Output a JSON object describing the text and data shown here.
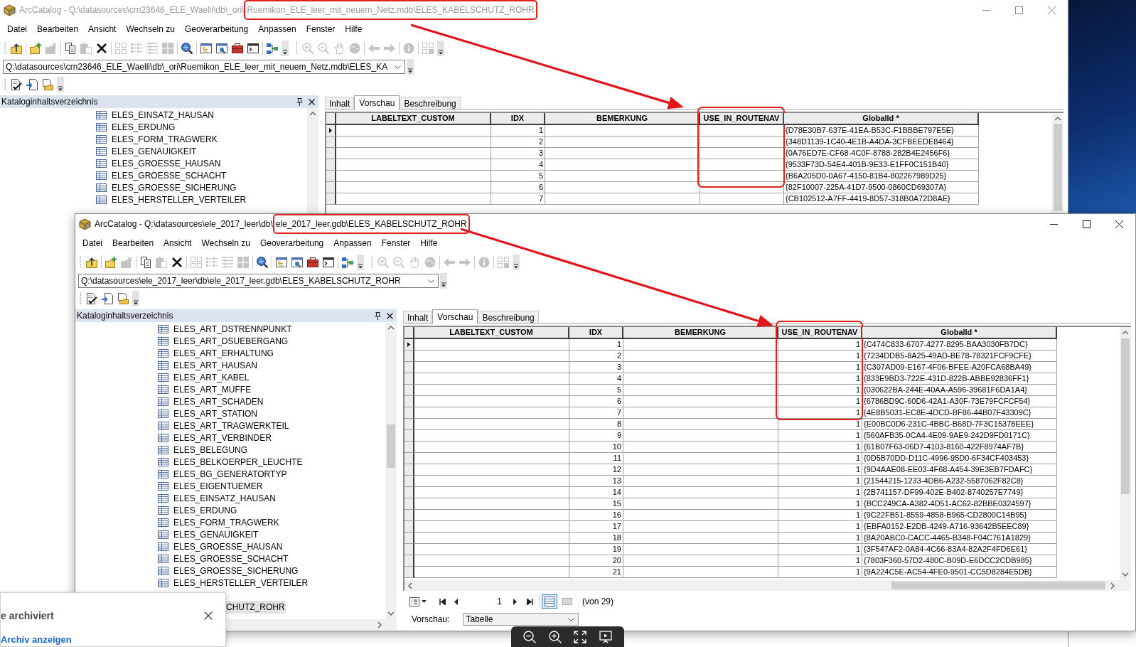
{
  "back_window": {
    "active": false,
    "title": "ArcCatalog - Q:\\datasources\\crn23646_ELE_Waelli\\db\\_ori\\",
    "title_marked": "Ruemikon_ELE_leer_mit_neuem_Netz.mdb\\ELES_KABELSCHUTZ_ROHR",
    "annotation_arrow": true,
    "menu": [
      "Datei",
      "Bearbeiten",
      "Ansicht",
      "Wechseln zu",
      "Geoverarbeitung",
      "Anpassen",
      "Fenster",
      "Hilfe"
    ],
    "toolbar": [
      {
        "kind": "grip"
      },
      {
        "kind": "up",
        "disabled": false
      },
      {
        "kind": "separator"
      },
      {
        "kind": "connect",
        "disabled": false
      },
      {
        "kind": "disconnect",
        "disabled": true
      },
      {
        "kind": "separator"
      },
      {
        "kind": "copy",
        "disabled": false
      },
      {
        "kind": "paste",
        "disabled": true
      },
      {
        "kind": "delete",
        "disabled": false
      },
      {
        "kind": "separator"
      },
      {
        "kind": "large_icons",
        "disabled": true
      },
      {
        "kind": "list",
        "disabled": true
      },
      {
        "kind": "details",
        "disabled": true
      },
      {
        "kind": "thumbnails",
        "disabled": true
      },
      {
        "kind": "separator"
      },
      {
        "kind": "search",
        "disabled": false
      },
      {
        "kind": "separator"
      },
      {
        "kind": "catalog_tree",
        "disabled": false
      },
      {
        "kind": "search_window",
        "disabled": false
      },
      {
        "kind": "toolbox",
        "disabled": false
      },
      {
        "kind": "python",
        "disabled": false
      },
      {
        "kind": "separator"
      },
      {
        "kind": "model",
        "disabled": false
      },
      {
        "kind": "overflow"
      },
      {
        "kind": "grip"
      },
      {
        "kind": "zoom_in",
        "disabled": true
      },
      {
        "kind": "zoom_out",
        "disabled": true
      },
      {
        "kind": "pan",
        "disabled": true
      },
      {
        "kind": "full_extent",
        "disabled": true
      },
      {
        "kind": "separator"
      },
      {
        "kind": "back",
        "disabled": true
      },
      {
        "kind": "forward",
        "disabled": true
      },
      {
        "kind": "separator"
      },
      {
        "kind": "identify",
        "disabled": true
      },
      {
        "kind": "separator"
      },
      {
        "kind": "thumbnail",
        "disabled": true
      },
      {
        "kind": "overflow"
      }
    ],
    "address": "Q:\\datasources\\crn23646_ELE_Waelli\\db\\_ori\\Ruemikon_ELE_leer_mit_neuem_Netz.mdb\\ELES_KA",
    "metadata_toolbar": [
      {
        "kind": "grip"
      },
      {
        "kind": "meta_edit",
        "disabled": false
      },
      {
        "kind": "meta_import",
        "disabled": false
      },
      {
        "kind": "meta_export",
        "disabled": false
      },
      {
        "kind": "overflow"
      }
    ],
    "catalog": {
      "title": "Kataloginhaltsverzeichnis",
      "items": [
        {
          "kind": "table",
          "label": "ELES_EINSATZ_HAUSAN",
          "selected": false
        },
        {
          "kind": "table",
          "label": "ELES_ERDUNG",
          "selected": false
        },
        {
          "kind": "table",
          "label": "ELES_FORM_TRAGWERK",
          "selected": false
        },
        {
          "kind": "table",
          "label": "ELES_GENAUIGKEIT",
          "selected": false
        },
        {
          "kind": "table",
          "label": "ELES_GROESSE_HAUSAN",
          "selected": false
        },
        {
          "kind": "table",
          "label": "ELES_GROESSE_SCHACHT",
          "selected": false
        },
        {
          "kind": "table",
          "label": "ELES_GROESSE_SICHERUNG",
          "selected": false
        },
        {
          "kind": "table",
          "label": "ELES_HERSTELLER_VERTEILER",
          "selected": false
        }
      ]
    },
    "tabs": [
      {
        "label": "Inhalt",
        "selected": false
      },
      {
        "label": "Vorschau",
        "selected": true
      },
      {
        "label": "Beschreibung",
        "selected": false
      }
    ],
    "table": {
      "columns": [
        {
          "label": "LABELTEXT_CUSTOM",
          "kind": "text",
          "marked": false
        },
        {
          "label": "IDX",
          "kind": "number",
          "marked": false
        },
        {
          "label": "BEMERKUNG",
          "kind": "text",
          "marked": false
        },
        {
          "label": "USE_IN_ROUTENAV",
          "kind": "number",
          "marked": true
        },
        {
          "label": "GlobalId *",
          "kind": "text",
          "marked": false
        }
      ],
      "rows": [
        {
          "current": true,
          "idx": "1",
          "globalid": "{D78E30B7-637E-41EA-B53C-F1BBBE797E5E}"
        },
        {
          "current": false,
          "idx": "2",
          "globalid": "{348D1139-1C40-4E1B-A4DA-3CFBEEDE8464}"
        },
        {
          "current": false,
          "idx": "3",
          "globalid": "{0A76ED7E-CF68-4C0F-8788-282B4E2456F6}"
        },
        {
          "current": false,
          "idx": "4",
          "globalid": "{9533F73D-54E4-401B-9E33-E1FF0C151B40}"
        },
        {
          "current": false,
          "idx": "5",
          "globalid": "{B6A205D0-0A67-4150-81B4-802267989D25}"
        },
        {
          "current": false,
          "idx": "6",
          "globalid": "{82F10007-225A-41D7-9500-0860CD69307A}"
        },
        {
          "current": false,
          "idx": "7",
          "globalid": "{CB102512-A7FF-4419-8D57-318B0A72D8AE}"
        }
      ]
    }
  },
  "front_window": {
    "active": true,
    "title": "ArcCatalog - Q:\\datasources\\ele_2017_leer\\db\\",
    "title_marked": "ele_2017_leer.gdb\\ELES_KABELSCHUTZ_ROHR",
    "annotation_arrow": true,
    "menu": [
      "Datei",
      "Bearbeiten",
      "Ansicht",
      "Wechseln zu",
      "Geoverarbeitung",
      "Anpassen",
      "Fenster",
      "Hilfe"
    ],
    "toolbar": [
      {
        "kind": "grip"
      },
      {
        "kind": "up",
        "disabled": false
      },
      {
        "kind": "separator"
      },
      {
        "kind": "connect",
        "disabled": false
      },
      {
        "kind": "disconnect",
        "disabled": true
      },
      {
        "kind": "separator"
      },
      {
        "kind": "copy",
        "disabled": false
      },
      {
        "kind": "paste",
        "disabled": true
      },
      {
        "kind": "delete",
        "disabled": false
      },
      {
        "kind": "separator"
      },
      {
        "kind": "large_icons",
        "disabled": true
      },
      {
        "kind": "list",
        "disabled": true
      },
      {
        "kind": "details",
        "disabled": true
      },
      {
        "kind": "thumbnails",
        "disabled": true
      },
      {
        "kind": "separator"
      },
      {
        "kind": "search",
        "disabled": false
      },
      {
        "kind": "separator"
      },
      {
        "kind": "catalog_tree",
        "disabled": false
      },
      {
        "kind": "search_window",
        "disabled": false
      },
      {
        "kind": "toolbox",
        "disabled": false
      },
      {
        "kind": "python",
        "disabled": false
      },
      {
        "kind": "separator"
      },
      {
        "kind": "model",
        "disabled": false
      },
      {
        "kind": "overflow"
      },
      {
        "kind": "grip"
      },
      {
        "kind": "zoom_in",
        "disabled": true
      },
      {
        "kind": "zoom_out",
        "disabled": true
      },
      {
        "kind": "pan",
        "disabled": true
      },
      {
        "kind": "full_extent",
        "disabled": true
      },
      {
        "kind": "separator"
      },
      {
        "kind": "back",
        "disabled": true
      },
      {
        "kind": "forward",
        "disabled": true
      },
      {
        "kind": "separator"
      },
      {
        "kind": "identify",
        "disabled": true
      },
      {
        "kind": "separator"
      },
      {
        "kind": "thumbnail",
        "disabled": true
      },
      {
        "kind": "overflow"
      }
    ],
    "address": "Q:\\datasources\\ele_2017_leer\\db\\ele_2017_leer.gdb\\ELES_KABELSCHUTZ_ROHR",
    "metadata_toolbar": [
      {
        "kind": "grip"
      },
      {
        "kind": "meta_edit",
        "disabled": false
      },
      {
        "kind": "meta_import",
        "disabled": false
      },
      {
        "kind": "meta_export",
        "disabled": false
      },
      {
        "kind": "overflow"
      }
    ],
    "catalog": {
      "title": "Kataloginhaltsverzeichnis",
      "items": [
        {
          "kind": "table",
          "label": "ELES_ART_DSTRENNPUNKT",
          "selected": false
        },
        {
          "kind": "table",
          "label": "ELES_ART_DSUEBERGANG",
          "selected": false
        },
        {
          "kind": "table",
          "label": "ELES_ART_ERHALTUNG",
          "selected": false
        },
        {
          "kind": "table",
          "label": "ELES_ART_HAUSAN",
          "selected": false
        },
        {
          "kind": "table",
          "label": "ELES_ART_KABEL",
          "selected": false
        },
        {
          "kind": "table",
          "label": "ELES_ART_MUFFE",
          "selected": false
        },
        {
          "kind": "table",
          "label": "ELES_ART_SCHADEN",
          "selected": false
        },
        {
          "kind": "table",
          "label": "ELES_ART_STATION",
          "selected": false
        },
        {
          "kind": "table",
          "label": "ELES_ART_TRAGWERKTEIL",
          "selected": false
        },
        {
          "kind": "table",
          "label": "ELES_ART_VERBINDER",
          "selected": false
        },
        {
          "kind": "table",
          "label": "ELES_BELEGUNG",
          "selected": false
        },
        {
          "kind": "table",
          "label": "ELES_BELKOERPER_LEUCHTE",
          "selected": false
        },
        {
          "kind": "table",
          "label": "ELES_BG_GENERATORTYP",
          "selected": false
        },
        {
          "kind": "table",
          "label": "ELES_EIGENTUEMER",
          "selected": false
        },
        {
          "kind": "table",
          "label": "ELES_EINSATZ_HAUSAN",
          "selected": false
        },
        {
          "kind": "table",
          "label": "ELES_ERDUNG",
          "selected": false
        },
        {
          "kind": "table",
          "label": "ELES_FORM_TRAGWERK",
          "selected": false
        },
        {
          "kind": "table",
          "label": "ELES_GENAUIGKEIT",
          "selected": false
        },
        {
          "kind": "table",
          "label": "ELES_GROESSE_HAUSAN",
          "selected": false
        },
        {
          "kind": "table",
          "label": "ELES_GROESSE_SCHACHT",
          "selected": false
        },
        {
          "kind": "table",
          "label": "ELES_GROESSE_SICHERUNG",
          "selected": false
        },
        {
          "kind": "table",
          "label": "ELES_HERSTELLER_VERTEILER",
          "selected": false
        },
        {
          "kind": "covered",
          "label": "CHUTZ_ROHR",
          "selected": true
        }
      ]
    },
    "tabs": [
      {
        "label": "Inhalt",
        "selected": false
      },
      {
        "label": "Vorschau",
        "selected": true
      },
      {
        "label": "Beschreibung",
        "selected": false
      }
    ],
    "table": {
      "columns": [
        {
          "label": "LABELTEXT_CUSTOM",
          "kind": "text",
          "marked": false
        },
        {
          "label": "IDX",
          "kind": "number",
          "marked": false
        },
        {
          "label": "BEMERKUNG",
          "kind": "text",
          "marked": false
        },
        {
          "label": "USE_IN_ROUTENAV",
          "kind": "number",
          "marked": true
        },
        {
          "label": "GlobalId *",
          "kind": "text",
          "marked": false
        }
      ],
      "rows": [
        {
          "current": true,
          "idx": "1",
          "use_in_routenav": "1",
          "globalid": "{C474C833-6707-4277-8295-BAA3030FB7DC}"
        },
        {
          "current": false,
          "idx": "2",
          "use_in_routenav": "1",
          "globalid": "{7234DDB5-8A25-49AD-BE78-78321FCF9CFE}"
        },
        {
          "current": false,
          "idx": "3",
          "use_in_routenav": "1",
          "globalid": "{C307AD09-E167-4F06-BFEE-A20FCA68BA49}"
        },
        {
          "current": false,
          "idx": "4",
          "use_in_routenav": "1",
          "globalid": "{833E9BD3-722E-431D-822B-ABBE92836FF1}"
        },
        {
          "current": false,
          "idx": "5",
          "use_in_routenav": "1",
          "globalid": "{030622BA-244E-40AA-A596-39681F6DA1A4}"
        },
        {
          "current": false,
          "idx": "6",
          "use_in_routenav": "1",
          "globalid": "{6786BD9C-60D6-42A1-A30F-73E79FCFCF54}"
        },
        {
          "current": false,
          "idx": "7",
          "use_in_routenav": "1",
          "globalid": "{4E8B5031-EC8E-4DCD-BF86-44B07F43309C}"
        },
        {
          "current": false,
          "idx": "8",
          "use_in_routenav": "1",
          "globalid": "{E00BC0D6-231C-4BBC-B68D-7F3C15378EEE}"
        },
        {
          "current": false,
          "idx": "9",
          "use_in_routenav": "1",
          "globalid": "{560AFB35-0CA4-4E09-9AE9-242D9FD0171C}"
        },
        {
          "current": false,
          "idx": "10",
          "use_in_routenav": "1",
          "globalid": "{61B07F63-06D7-4103-8160-422F8974AF7B}"
        },
        {
          "current": false,
          "idx": "11",
          "use_in_routenav": "1",
          "globalid": "{0D5B70DD-D11C-4996-95D0-6F34CF403453}"
        },
        {
          "current": false,
          "idx": "12",
          "use_in_routenav": "1",
          "globalid": "{9D4AAE08-EE03-4F68-A454-39E3EB7FDAFC}"
        },
        {
          "current": false,
          "idx": "13",
          "use_in_routenav": "1",
          "globalid": "{21544215-1233-4DB6-A232-5587062F82C8}"
        },
        {
          "current": false,
          "idx": "14",
          "use_in_routenav": "1",
          "globalid": "{2B741157-DF99-402E-B402-8740257E7749}"
        },
        {
          "current": false,
          "idx": "15",
          "use_in_routenav": "1",
          "globalid": "{BCC249CA-A382-4D51-AC62-82BBE0324597}"
        },
        {
          "current": false,
          "idx": "16",
          "use_in_routenav": "1",
          "globalid": "{9C22FB51-8559-4858-B965-CD2800C14B95}"
        },
        {
          "current": false,
          "idx": "17",
          "use_in_routenav": "1",
          "globalid": "{EBFA0152-E2DB-4249-A716-93642B5EEC89}"
        },
        {
          "current": false,
          "idx": "18",
          "use_in_routenav": "1",
          "globalid": "{8A20ABC0-CACC-4465-B348-F04C761A1829}"
        },
        {
          "current": false,
          "idx": "19",
          "use_in_routenav": "1",
          "globalid": "{3F547AF2-0A84-4C66-83A4-82A2F4FD6E61}"
        },
        {
          "current": false,
          "idx": "20",
          "use_in_routenav": "1",
          "globalid": "{7803F360-57D2-480C-B09D-E6DCC2CDB985}"
        },
        {
          "current": false,
          "idx": "21",
          "use_in_routenav": "1",
          "globalid": "{9A224C5E-AC54-4FE0-9501-CC5D8284E5DB}"
        }
      ]
    },
    "navigator": {
      "page": "1",
      "total": "(von 29)",
      "views": [
        {
          "kind": "all_records",
          "selected": true
        },
        {
          "kind": "selected_records",
          "selected": false
        }
      ]
    },
    "preview": {
      "label": "Vorschau:",
      "value": "Tabelle"
    }
  },
  "notification": {
    "title": "e archiviert",
    "link": "Archiv anzeigen"
  },
  "viewer_toolbar": [
    {
      "kind": "zoom_out"
    },
    {
      "kind": "zoom_in"
    },
    {
      "kind": "fit"
    },
    {
      "kind": "slideshow"
    }
  ]
}
